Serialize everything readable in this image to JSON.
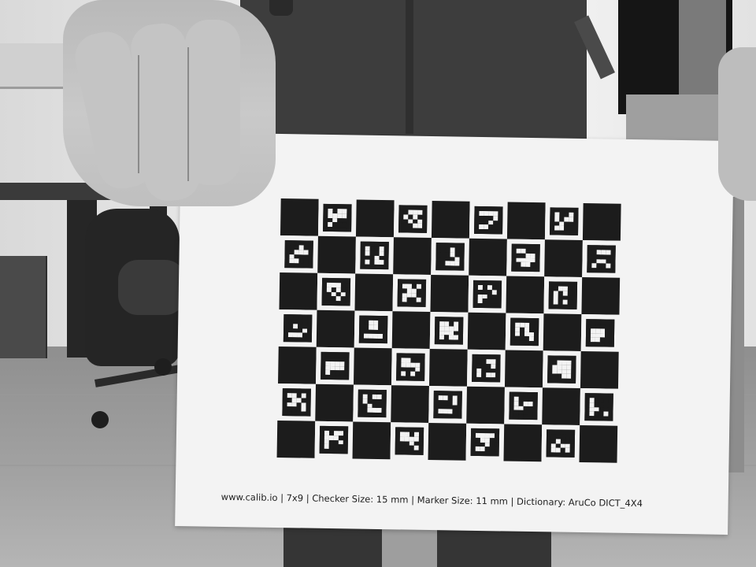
{
  "photo": {
    "board": {
      "pattern": [
        [
          "B",
          "W",
          "B",
          "W",
          "B",
          "W",
          "B",
          "W",
          "B"
        ],
        [
          "W",
          "B",
          "W",
          "B",
          "W",
          "B",
          "W",
          "B",
          "W"
        ],
        [
          "B",
          "W",
          "B",
          "W",
          "B",
          "W",
          "B",
          "W",
          "B"
        ],
        [
          "W",
          "B",
          "W",
          "B",
          "W",
          "B",
          "W",
          "B",
          "W"
        ],
        [
          "B",
          "W",
          "B",
          "W",
          "B",
          "W",
          "B",
          "W",
          "B"
        ],
        [
          "W",
          "B",
          "W",
          "B",
          "W",
          "B",
          "W",
          "B",
          "W"
        ],
        [
          "B",
          "W",
          "B",
          "W",
          "B",
          "W",
          "B",
          "W",
          "B"
        ]
      ]
    },
    "caption": "www.calib.io | 7x9 | Checker Size: 15 mm | Marker Size: 11 mm | Dictionary: AruCo DICT_4X4"
  },
  "colors": {
    "board_black": "#1c1c1c",
    "paper_white": "#f3f3f3"
  }
}
